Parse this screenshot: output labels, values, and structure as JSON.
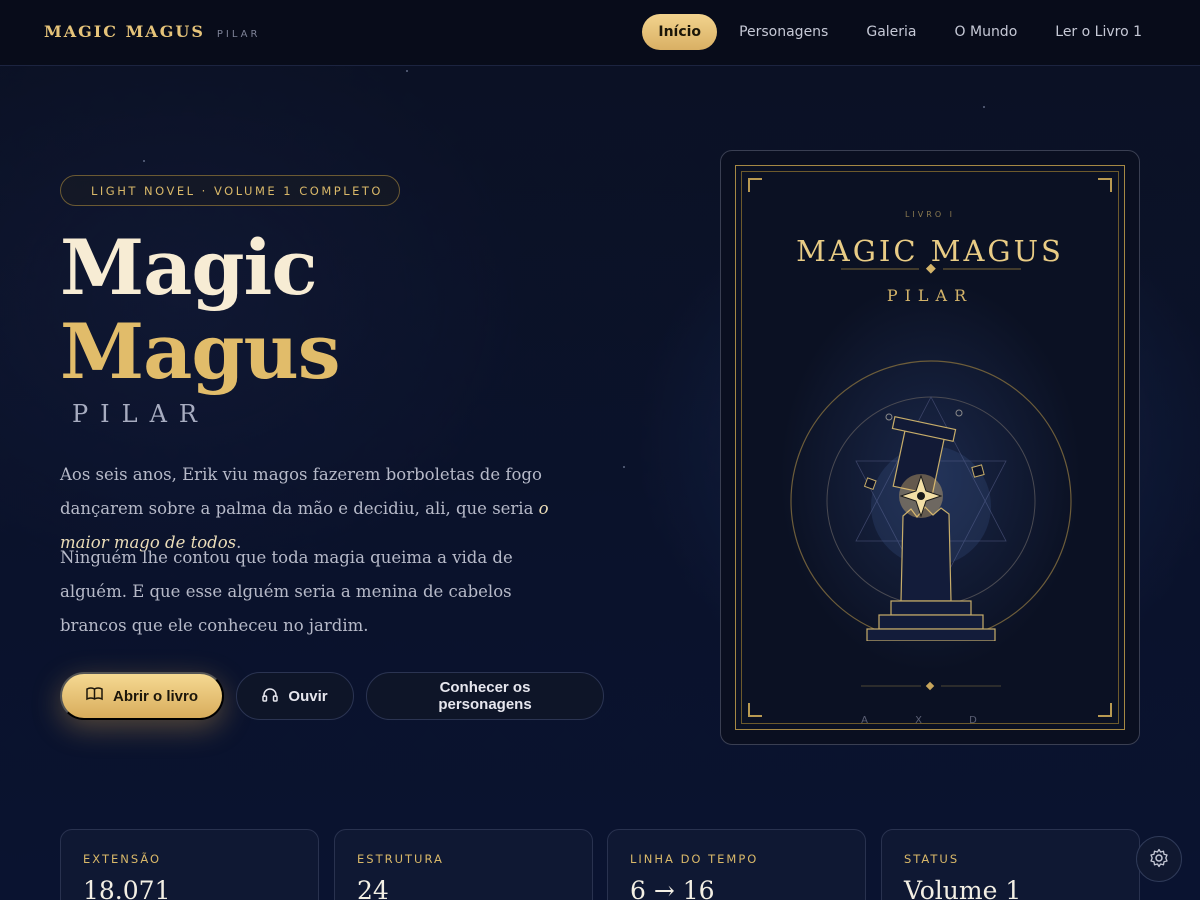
{
  "brand": {
    "name": "MAGIC MAGUS",
    "sub": "PILAR"
  },
  "nav": [
    {
      "label": "Início",
      "active": true
    },
    {
      "label": "Personagens",
      "active": false
    },
    {
      "label": "Galeria",
      "active": false
    },
    {
      "label": "O Mundo",
      "active": false
    },
    {
      "label": "Ler o Livro 1",
      "active": false
    }
  ],
  "hero": {
    "badge": "LIGHT NOVEL · VOLUME 1 COMPLETO",
    "title_line1": "Magic",
    "title_line2": "Magus",
    "subtitle": "PILAR",
    "p1_before": "Aos seis anos, Erik viu magos fazerem borboletas de fogo dançarem sobre a palma da mão e decidiu, ali, que seria ",
    "p1_em": "o maior mago de todos",
    "p1_after": ".",
    "p2": "Ninguém lhe contou que toda magia queima a vida de alguém. E que esse alguém seria a menina de cabelos brancos que ele conheceu no jardim.",
    "btn_open": "Abrir o livro",
    "btn_listen": "Ouvir",
    "btn_chars": "Conhecer os personagens"
  },
  "cover": {
    "kicker": "LIVRO I",
    "title": "MAGIC MAGUS",
    "subtitle": "PILAR",
    "runes": "A X D"
  },
  "stats": [
    {
      "label": "EXTENSÃO",
      "value": "18.071"
    },
    {
      "label": "ESTRUTURA",
      "value": "24"
    },
    {
      "label": "LINHA DO TEMPO",
      "value": "6 → 16"
    },
    {
      "label": "STATUS",
      "value": "Volume 1"
    }
  ],
  "colors": {
    "gold": "#e1bc6a",
    "background": "#0a1024",
    "accent_button": "#f2d38e"
  },
  "icons": {
    "open_book": "book-open-icon",
    "listen": "headphones-icon",
    "settings": "gear-icon"
  }
}
